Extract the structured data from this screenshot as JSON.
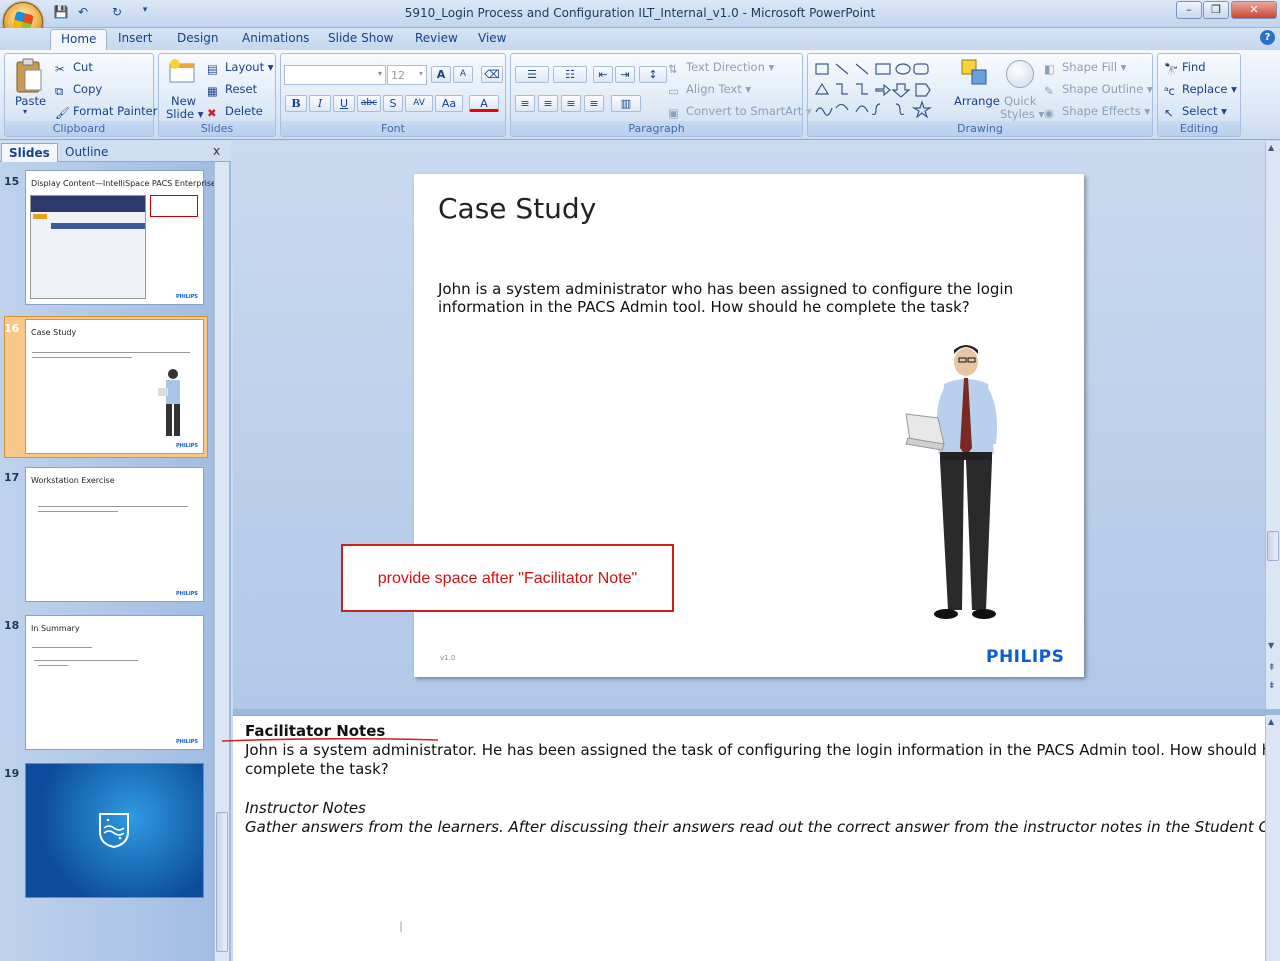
{
  "window": {
    "title": "5910_Login Process and Configuration ILT_Internal_v1.0 - Microsoft PowerPoint",
    "minimize": "–",
    "maximize": "❐",
    "close": "✕"
  },
  "qat": {
    "save": "💾",
    "undo": "↶",
    "redo": "↻",
    "more": "▾"
  },
  "tabs": [
    "Home",
    "Insert",
    "Design",
    "Animations",
    "Slide Show",
    "Review",
    "View"
  ],
  "ribbon": {
    "clipboard": {
      "paste": "Paste",
      "cut": "Cut",
      "copy": "Copy",
      "format_painter": "Format Painter",
      "label": "Clipboard"
    },
    "slides": {
      "new_slide": "New",
      "new_slide2": "Slide ▾",
      "layout": "Layout ▾",
      "reset": "Reset",
      "delete": "Delete",
      "label": "Slides"
    },
    "font": {
      "font_size": "12",
      "label": "Font",
      "bold": "B",
      "italic": "I",
      "underline": "U",
      "strike": "abc",
      "shadow": "S",
      "spacing": "AV",
      "case": "Aa",
      "color": "A",
      "grow": "A",
      "shrink": "A"
    },
    "paragraph": {
      "text_direction": "Text Direction ▾",
      "align_text": "Align Text ▾",
      "convert_smartart": "Convert to SmartArt ▾",
      "label": "Paragraph"
    },
    "drawing": {
      "arrange": "Arrange",
      "quick_styles": "Quick",
      "quick_styles2": "Styles ▾",
      "shape_fill": "Shape Fill ▾",
      "shape_outline": "Shape Outline ▾",
      "shape_effects": "Shape Effects ▾",
      "label": "Drawing"
    },
    "editing": {
      "find": "Find",
      "replace": "Replace ▾",
      "select": "Select ▾",
      "label": "Editing"
    }
  },
  "pane": {
    "tab_slides": "Slides",
    "tab_outline": "Outline",
    "close": "x"
  },
  "thumbnails": [
    {
      "num": "15",
      "title": "Display Content—IntelliSpace PACS Enterprise"
    },
    {
      "num": "16",
      "title": "Case Study"
    },
    {
      "num": "17",
      "title": "Workstation Exercise"
    },
    {
      "num": "18",
      "title": "In Summary"
    },
    {
      "num": "19",
      "title": ""
    }
  ],
  "thumb_logo": "PHILIPS",
  "slide": {
    "title": "Case Study",
    "body": "John is a system administrator who has been assigned to configure the login information in the PACS Admin tool. How should he complete the task?",
    "version": "v1.0",
    "logo": "PHILIPS"
  },
  "callout": "provide space after \"Facilitator Note\"",
  "notes": {
    "heading": "Facilitator Notes",
    "line1": "John is a system administrator. He has been assigned the task of configuring the login information in the PACS Admin tool. How should he",
    "line2": "complete the task?",
    "instr_heading": "Instructor Notes",
    "instr_body": "Gather answers from the learners. After discussing their answers read out the correct answer from the instructor notes in the Student Guide."
  },
  "colors": {
    "accent": "#0b5ed7",
    "callout": "#cc1f1f",
    "ribbon_text": "#15428b"
  }
}
